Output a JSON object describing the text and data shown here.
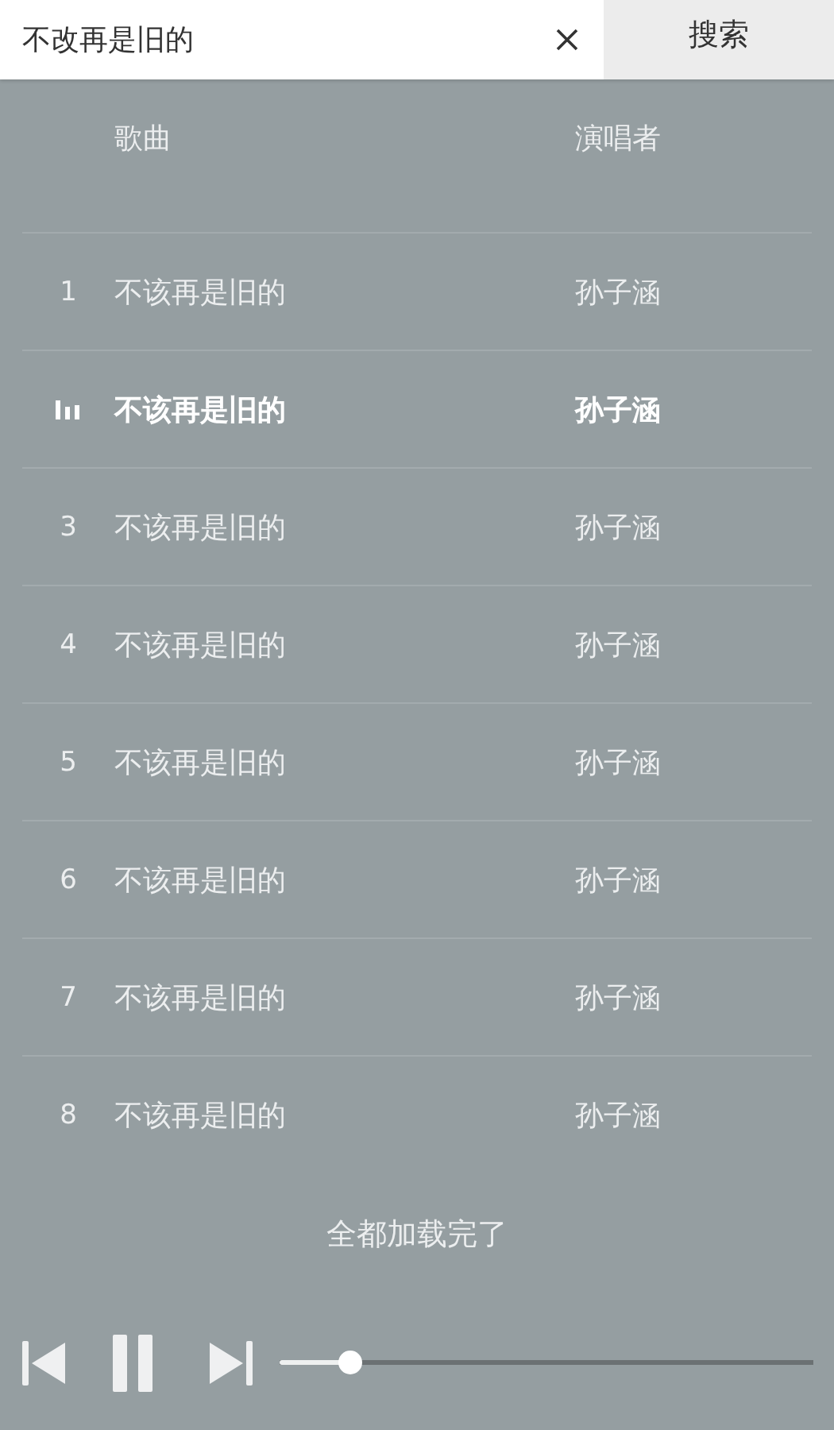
{
  "search": {
    "value": "不改再是旧的",
    "button": "搜索"
  },
  "table": {
    "columns": [
      "歌曲",
      "演唱者"
    ],
    "rows": [
      {
        "number": "1",
        "title": "不该再是旧的",
        "artist": "孙子涵",
        "selected": false
      },
      {
        "title": "不该再是旧的",
        "artist": "孙子涵",
        "selected": true
      },
      {
        "number": "3",
        "title": "不该再是旧的",
        "artist": "孙子涵",
        "selected": false
      },
      {
        "number": "4",
        "title": "不该再是旧的",
        "artist": "孙子涵",
        "selected": false
      },
      {
        "number": "5",
        "title": "不该再是旧的",
        "artist": "孙子涵",
        "selected": false
      },
      {
        "number": "6",
        "title": "不该再是旧的",
        "artist": "孙子涵",
        "selected": false
      },
      {
        "number": "7",
        "title": "不该再是旧的",
        "artist": "孙子涵",
        "selected": false
      },
      {
        "number": "8",
        "title": "不该再是旧的",
        "artist": "孙子涵",
        "selected": false
      }
    ]
  },
  "footer": "全都加载完了",
  "player": {
    "playing": true,
    "progress": {
      "level": 0.13
    }
  }
}
